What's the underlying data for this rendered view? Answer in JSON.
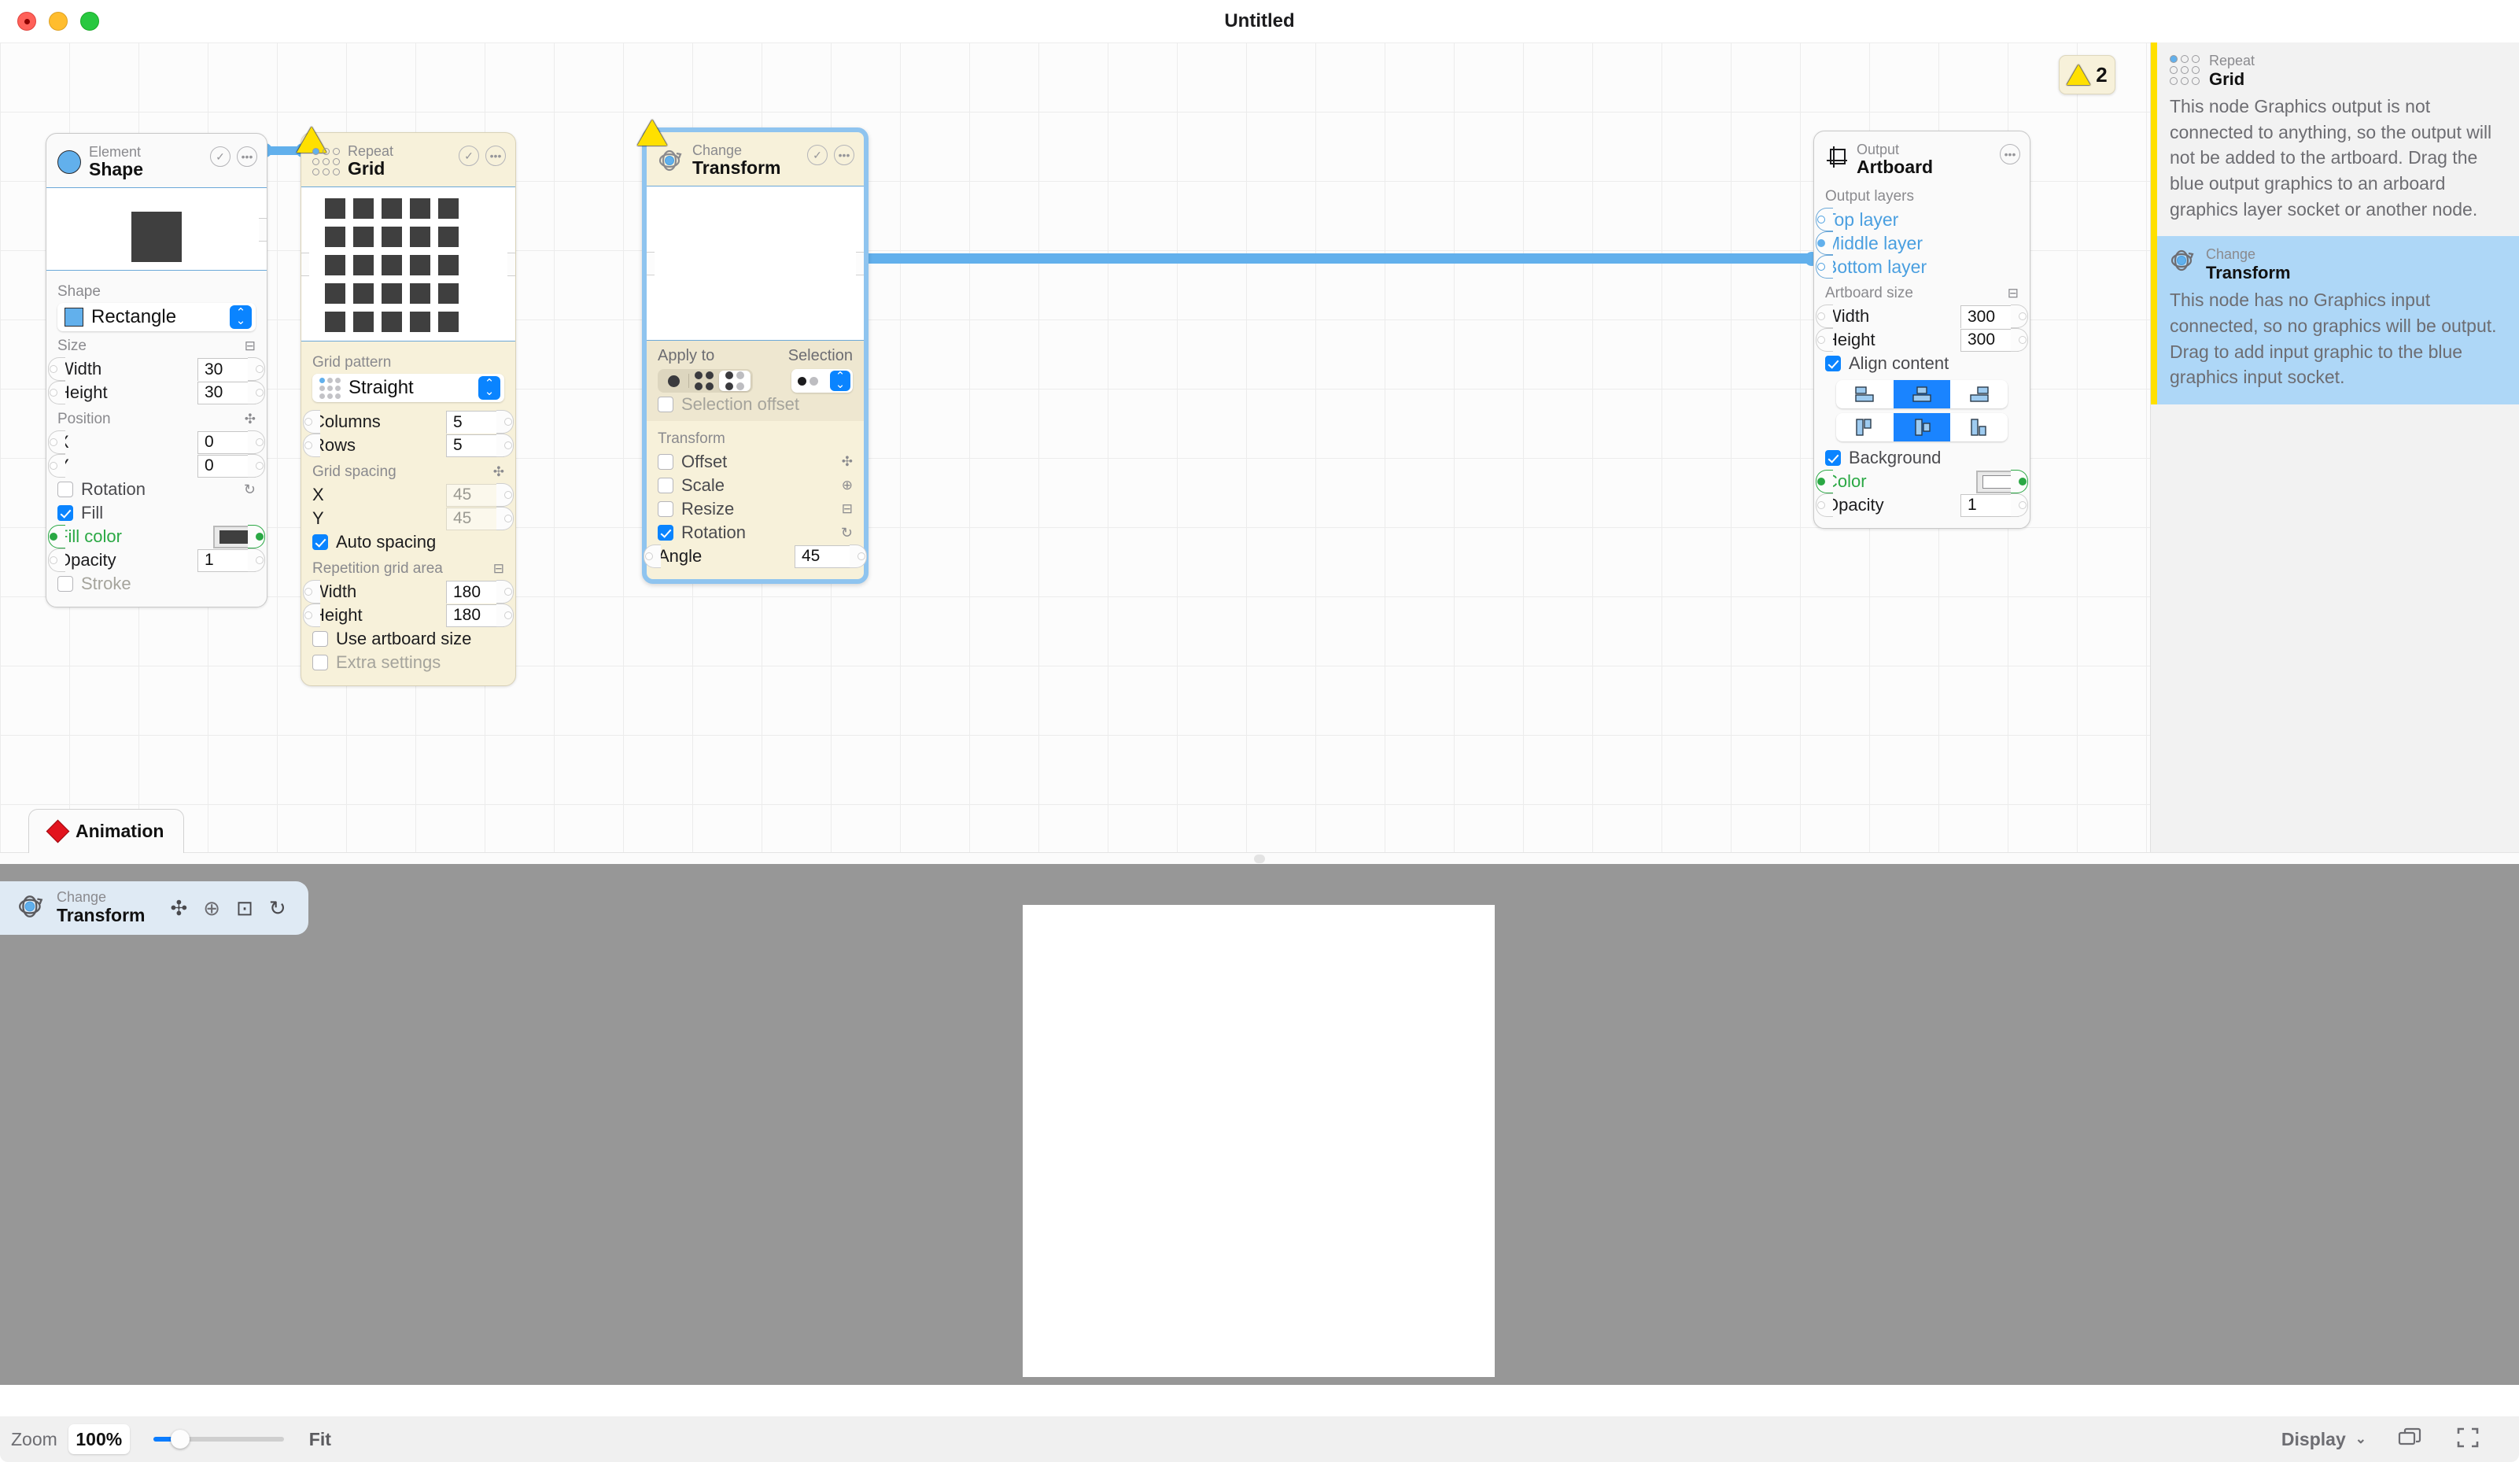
{
  "window": {
    "title": "Untitled"
  },
  "traffic_lights": {
    "close": "close-button",
    "minimize": "minimize-button",
    "zoom": "zoom-button"
  },
  "nodes": {
    "shape": {
      "kind": "Element",
      "title": "Shape",
      "icon": "circle-icon",
      "shape_label": "Shape",
      "shape_value": "Rectangle",
      "size_label": "Size",
      "width_label": "Width",
      "width_value": "30",
      "height_label": "Height",
      "height_value": "30",
      "position_label": "Position",
      "x_label": "X",
      "x_value": "0",
      "y_label": "Y",
      "y_value": "0",
      "rotation_label": "Rotation",
      "rotation_checked": false,
      "fill_label": "Fill",
      "fill_checked": true,
      "fill_color_label": "Fill color",
      "fill_color": "#3f3f3f",
      "opacity_label": "Opacity",
      "opacity_value": "1",
      "stroke_label": "Stroke",
      "stroke_checked": false
    },
    "grid": {
      "kind": "Repeat",
      "title": "Grid",
      "icon": "grid-dots-icon",
      "has_warning": true,
      "grid_pattern_label": "Grid pattern",
      "grid_pattern_value": "Straight",
      "columns_label": "Columns",
      "columns_value": "5",
      "rows_label": "Rows",
      "rows_value": "5",
      "grid_spacing_label": "Grid spacing",
      "spacing_x_label": "X",
      "spacing_x_value": "45",
      "spacing_y_label": "Y",
      "spacing_y_value": "45",
      "auto_spacing_label": "Auto spacing",
      "auto_spacing_checked": true,
      "repetition_area_label": "Repetition grid area",
      "area_width_label": "Width",
      "area_width_value": "180",
      "area_height_label": "Height",
      "area_height_value": "180",
      "use_artboard_label": "Use artboard size",
      "use_artboard_checked": false,
      "extra_settings_label": "Extra settings",
      "extra_settings_checked": false
    },
    "transform": {
      "kind": "Change",
      "title": "Transform",
      "icon": "transform-orbit-icon",
      "has_warning": true,
      "selected": true,
      "apply_to_label": "Apply to",
      "selection_label": "Selection",
      "apply_options": [
        "single-dot-icon",
        "four-dots-icon",
        "four-dots-partial-icon"
      ],
      "apply_selected_index": 2,
      "selection_value_icon": "two-dots-icon",
      "selection_offset_label": "Selection offset",
      "selection_offset_checked": false,
      "transform_label": "Transform",
      "offset_label": "Offset",
      "offset_checked": false,
      "scale_label": "Scale",
      "scale_checked": false,
      "resize_label": "Resize",
      "resize_checked": false,
      "rotation_label": "Rotation",
      "rotation_checked": true,
      "angle_label": "Angle",
      "angle_value": "45"
    },
    "artboard": {
      "kind": "Output",
      "title": "Artboard",
      "icon": "artboard-frame-icon",
      "output_layers_label": "Output layers",
      "layers": [
        "Top layer",
        "Middle layer",
        "Bottom layer"
      ],
      "connected_layer_index": 1,
      "artboard_size_label": "Artboard size",
      "width_label": "Width",
      "width_value": "300",
      "height_label": "Height",
      "height_value": "300",
      "align_content_label": "Align content",
      "align_content_checked": true,
      "align_h_options": [
        "align-top-icon",
        "align-middle-icon",
        "align-bottom-icon"
      ],
      "align_h_selected": 1,
      "align_v_options": [
        "align-left-icon",
        "align-center-icon",
        "align-right-icon"
      ],
      "align_v_selected": 1,
      "background_label": "Background",
      "background_checked": true,
      "color_label": "Color",
      "color_value": "#ffffff",
      "opacity_label": "Opacity",
      "opacity_value": "1"
    }
  },
  "warnings": {
    "badge_count": "2",
    "items": [
      {
        "kind": "Repeat",
        "name": "Grid",
        "icon": "grid-dots-icon",
        "text": "This node Graphics output is not connected to anything, so the output will not be added to the artboard. Drag the blue output graphics to an arboard graphics layer socket or another node."
      },
      {
        "kind": "Change",
        "name": "Transform",
        "icon": "transform-orbit-icon",
        "text": "This node has no Graphics input connected, so no graphics will be output. Drag to add input graphic to the blue graphics input socket."
      }
    ]
  },
  "animation_tab": {
    "label": "Animation",
    "icon": "red-diamond-icon"
  },
  "viewport_pill": {
    "kind": "Change",
    "name": "Transform",
    "icon": "transform-orbit-icon",
    "tools": [
      "move-tool-icon",
      "scale-tool-icon",
      "resize-tool-icon",
      "rotate-tool-icon"
    ]
  },
  "statusbar": {
    "zoom_label": "Zoom",
    "zoom_value": "100%",
    "fit_label": "Fit",
    "display_label": "Display",
    "display_chevron": "chevron-down-icon",
    "layers_icon": "layers-icon",
    "fullscreen_icon": "fullscreen-icon"
  },
  "grid_preview": {
    "columns": 5,
    "rows": 5,
    "square_color": "#3f3f3f"
  },
  "colors": {
    "accent": "#0a84ff",
    "wire": "#62b0ec",
    "warning": "#ffe000",
    "node_warm": "#f7f1da",
    "green_socket": "#2aa844"
  }
}
